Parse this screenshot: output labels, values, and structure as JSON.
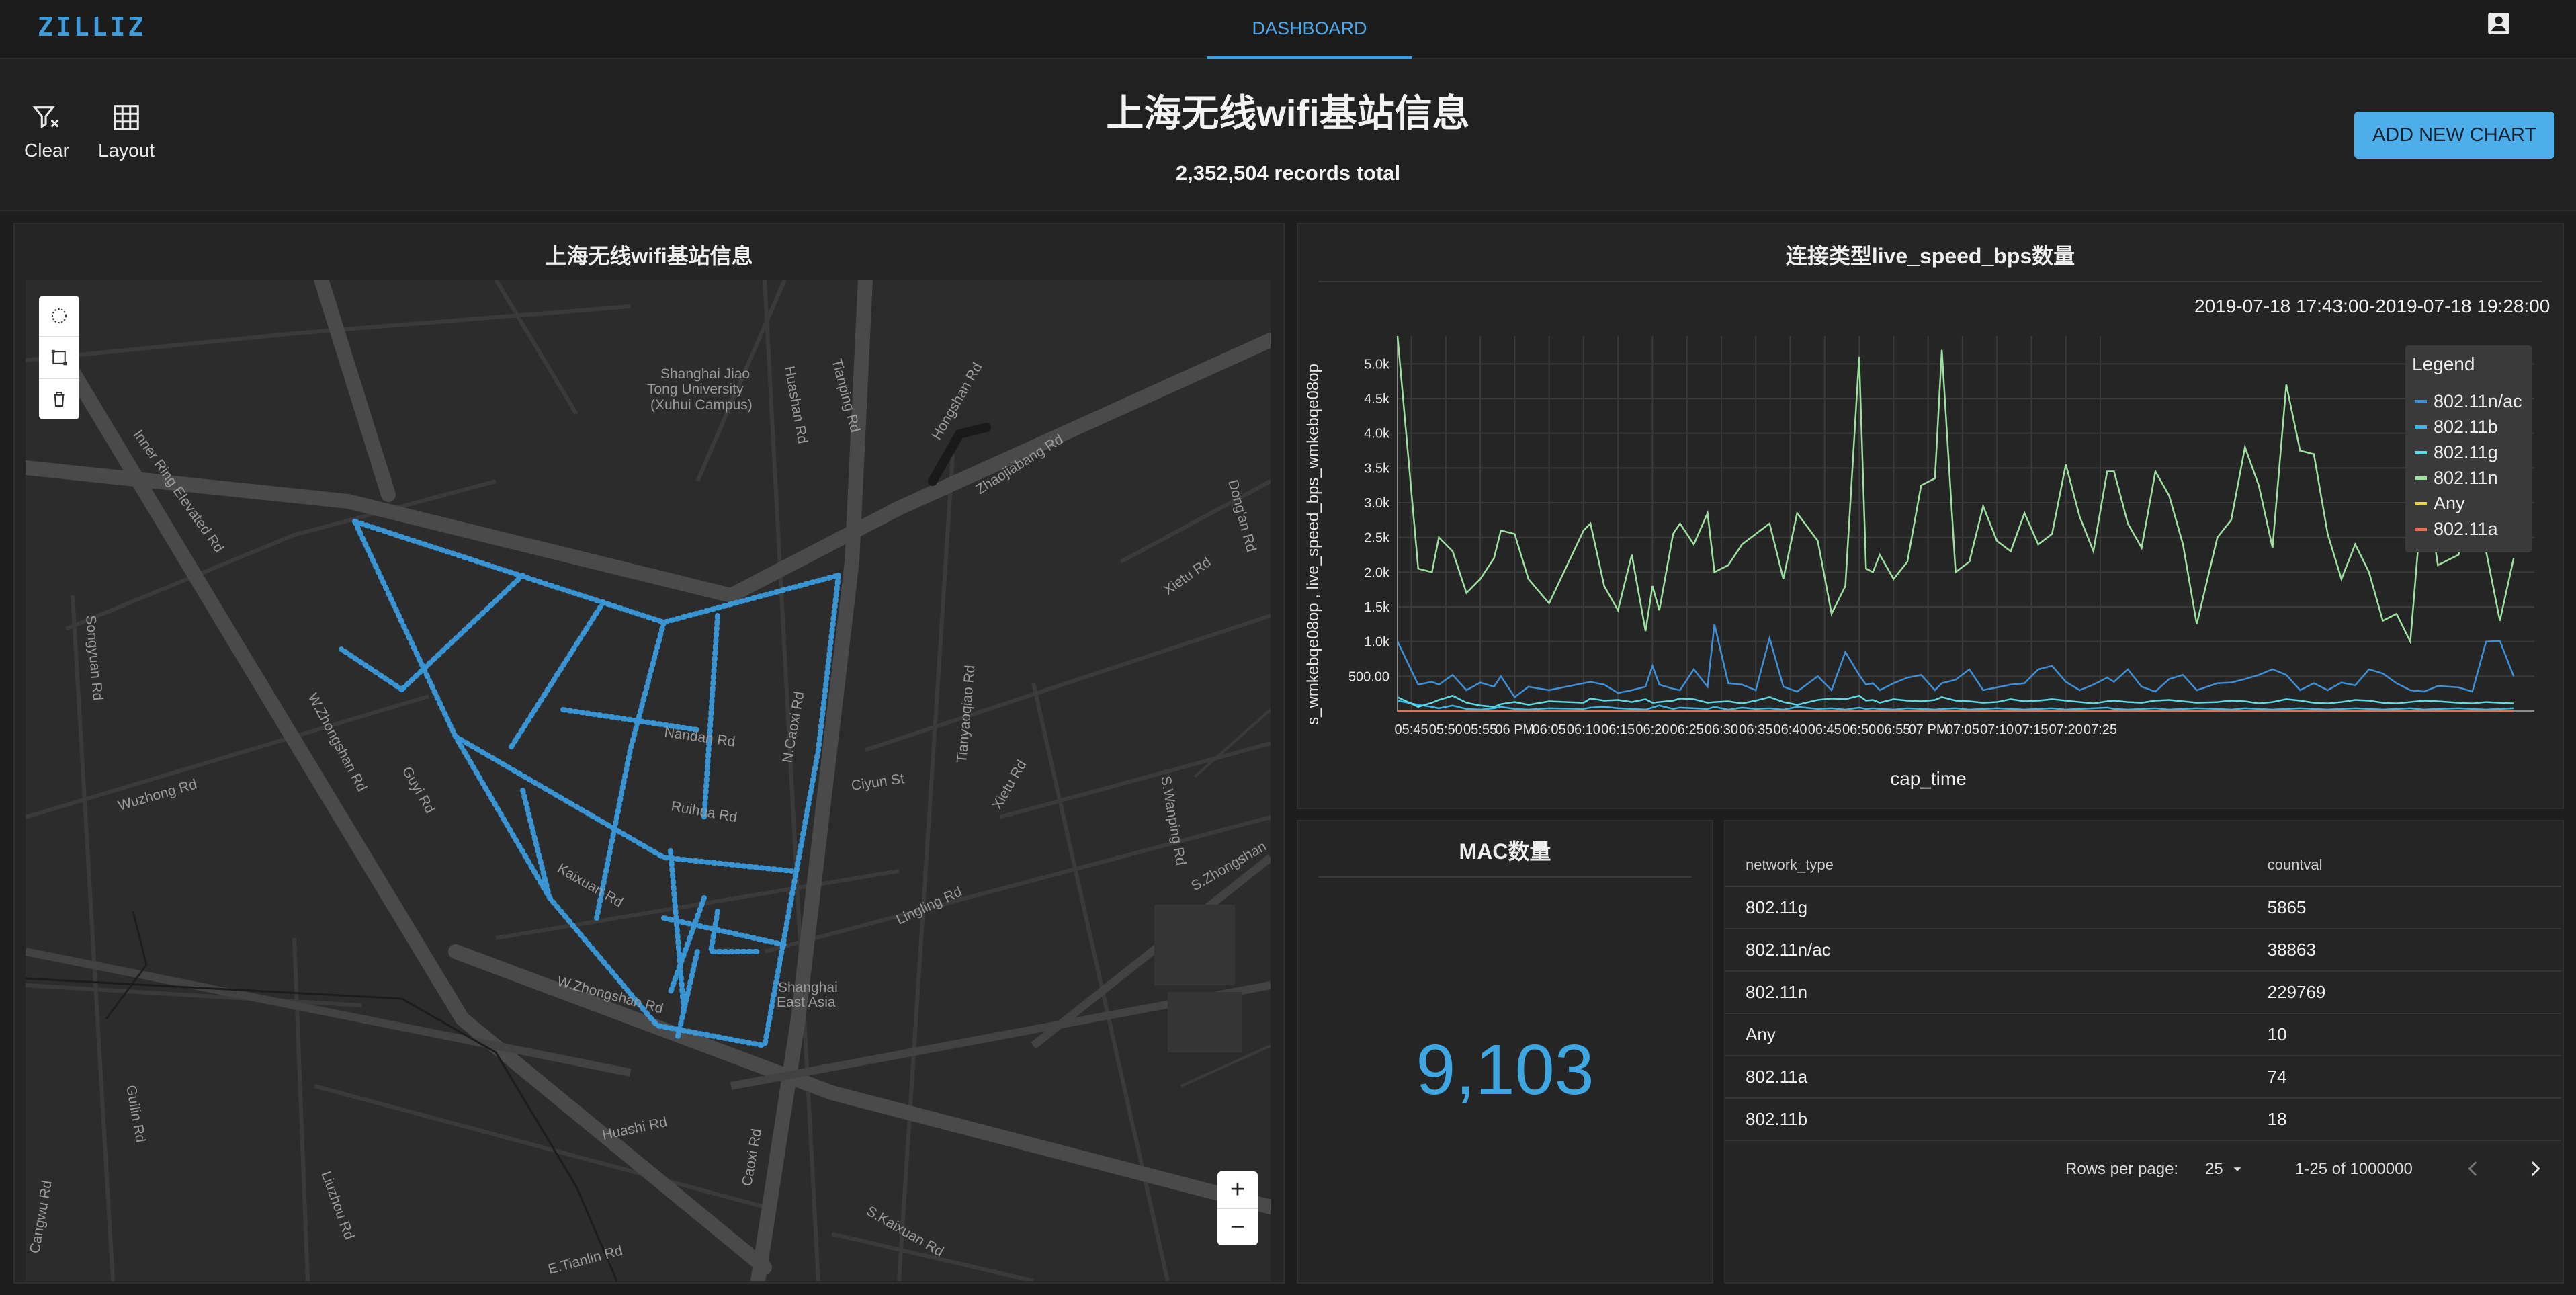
{
  "app": {
    "logo": "ZILLIZ",
    "nav_tab": "DASHBOARD"
  },
  "header": {
    "title": "上海无线wifi基站信息",
    "records": "2,352,504 records total",
    "tools": {
      "clear": "Clear",
      "layout": "Layout"
    },
    "add_chart": "ADD NEW CHART"
  },
  "map_panel": {
    "title": "上海无线wifi基站信息",
    "labels": {
      "sjtu": "Shanghai Jiao",
      "sjtu2": "Tong University",
      "sjtu3": "(Xuhui Campus)",
      "inner_ring": "Inner Ring Elevated Rd",
      "zhaojiabang": "Zhaojiabang Rd",
      "hongshan": "Hongshan Rd",
      "huashan": "Huashan Rd",
      "tianping": "Tianping Rd",
      "songyuan": "Songyuan Rd",
      "zhongshan_w": "W.Zhongshan Rd",
      "wuzhong": "Wuzhong Rd",
      "nandan": "Nandan Rd",
      "nandan_e": "Nandan Rd",
      "caoxi_n": "N.Caoxi Rd",
      "kaixuan": "Kaixuan Rd",
      "wzhongshan": "W.Zhongshan Rd",
      "tianyaoqiao": "Tianyaoqiao Rd",
      "lingling": "Lingling Rd",
      "xietu": "Xietu Rd",
      "xietu2": "Xietu Rd",
      "ciyun": "Ciyun St",
      "guyi": "Guyi Rd",
      "shanghai_ea": "Shanghai",
      "shanghai_ea2": "East Asia",
      "huashi": "Huashi Rd",
      "caoxi": "Caoxi Rd",
      "kaixuan_s": "S.Kaixuan Rd",
      "luizhou": "Liuzhou Rd",
      "guilin": "Guilin Rd",
      "tianlin": "E.Tianlin Rd",
      "wanping": "S.Wanping Rd",
      "dongan": "Dong'an Rd",
      "zhongshan_s": "S.Zhongshan",
      "caoxi_rd": "Caoxi Rd",
      "cangwu": "Cangwu Rd",
      "zhongshan2": "Zhongshan Rd",
      "rui": "Ruihua Rd",
      "zhangliang": "Zhaojiabang Rd"
    }
  },
  "line_panel": {
    "title": "连接类型live_speed_bps数量",
    "range": "2019-07-18 17:43:00-2019-07-18 19:28:00",
    "legend_title": "Legend"
  },
  "chart_data": {
    "type": "line",
    "title": "连接类型live_speed_bps数量",
    "xlabel": "cap_time",
    "ylabel": "s_wmkebqe08op , live_speed_bps_wmkebqe08op",
    "x_ticks": [
      "05:45",
      "05:50",
      "05:55",
      "06 PM",
      "06:05",
      "06:10",
      "06:15",
      "06:20",
      "06:25",
      "06:30",
      "06:35",
      "06:40",
      "06:45",
      "06:50",
      "06:55",
      "07 PM",
      "07:05",
      "07:10",
      "07:15",
      "07:20",
      "07:25"
    ],
    "y_ticks": [
      "500.00",
      "1.0k",
      "1.5k",
      "2.0k",
      "2.5k",
      "3.0k",
      "3.5k",
      "4.0k",
      "4.5k",
      "5.0k"
    ],
    "ylim": [
      0,
      5400
    ],
    "grid": true,
    "legend_position": "top-right",
    "x_minutes": [
      43,
      46,
      48,
      49,
      51,
      53,
      55,
      57,
      58,
      60,
      62,
      65,
      70,
      71,
      73,
      75,
      77,
      79,
      80,
      81,
      83,
      84,
      86,
      88,
      89,
      91,
      93,
      95,
      97,
      99,
      101,
      104,
      106,
      108,
      110,
      111,
      112,
      113,
      115,
      117,
      119,
      121,
      122,
      124,
      126,
      128,
      130,
      132,
      134,
      136,
      138,
      140,
      142,
      144,
      146,
      147,
      149,
      151,
      153,
      155,
      157,
      159,
      162,
      164,
      166,
      168,
      170,
      172,
      174,
      176,
      178,
      180,
      182,
      184,
      186,
      188,
      190,
      192,
      194,
      197,
      199,
      201,
      203,
      205
    ],
    "series": [
      {
        "name": "802.11n/ac",
        "color": "#3e8fd6",
        "values": [
          1000,
          380,
          420,
          380,
          520,
          300,
          410,
          350,
          500,
          200,
          350,
          300,
          400,
          420,
          380,
          260,
          300,
          350,
          650,
          380,
          320,
          300,
          600,
          350,
          1250,
          400,
          380,
          300,
          1050,
          350,
          280,
          500,
          300,
          850,
          520,
          380,
          400,
          300,
          400,
          480,
          520,
          300,
          400,
          450,
          600,
          300,
          340,
          380,
          400,
          600,
          650,
          420,
          300,
          380,
          480,
          420,
          600,
          350,
          280,
          460,
          520,
          300,
          400,
          410,
          460,
          520,
          600,
          520,
          300,
          400,
          300,
          410,
          370,
          600,
          540,
          400,
          300,
          280,
          360,
          340,
          280,
          1000,
          1010,
          500
        ]
      },
      {
        "name": "802.11b",
        "color": "#35b7e8",
        "values": [
          150,
          90,
          60,
          40,
          80,
          30,
          20,
          40,
          60,
          30,
          20,
          40,
          30,
          50,
          60,
          40,
          30,
          20,
          50,
          80,
          30,
          50,
          40,
          30,
          60,
          20,
          50,
          30,
          40,
          20,
          60,
          30,
          40,
          20,
          50,
          30,
          40,
          30,
          20,
          40,
          30,
          20,
          30,
          40,
          20,
          30,
          40,
          30,
          20,
          30,
          40,
          20,
          30,
          40,
          50,
          30,
          20,
          30,
          40,
          20,
          30,
          40,
          30,
          20,
          40,
          30,
          20,
          30,
          40,
          30,
          20,
          30,
          40,
          30,
          20,
          30,
          40,
          20,
          30,
          40,
          30,
          20,
          30,
          40
        ]
      },
      {
        "name": "802.11g",
        "color": "#5ed9e6",
        "values": [
          200,
          60,
          120,
          160,
          220,
          120,
          80,
          60,
          100,
          130,
          90,
          140,
          120,
          180,
          150,
          160,
          130,
          170,
          120,
          130,
          150,
          180,
          170,
          120,
          130,
          140,
          110,
          150,
          200,
          130,
          90,
          160,
          180,
          170,
          220,
          150,
          160,
          120,
          170,
          150,
          140,
          160,
          200,
          150,
          140,
          120,
          130,
          170,
          140,
          150,
          170,
          150,
          130,
          110,
          140,
          150,
          130,
          120,
          150,
          160,
          140,
          120,
          130,
          150,
          140,
          110,
          130,
          170,
          150,
          120,
          110,
          130,
          160,
          150,
          120,
          110,
          130,
          150,
          140,
          120,
          110,
          130,
          120,
          110
        ]
      },
      {
        "name": "802.11n",
        "color": "#9ee0a0",
        "values": [
          5400,
          2050,
          2000,
          2500,
          2300,
          1700,
          1900,
          2200,
          2600,
          2550,
          1900,
          1550,
          2600,
          2700,
          1800,
          1450,
          2250,
          1150,
          1800,
          1450,
          2550,
          2700,
          2400,
          2850,
          2000,
          2100,
          2400,
          2550,
          2700,
          1900,
          2850,
          2450,
          1400,
          1800,
          5100,
          2050,
          2000,
          2250,
          1900,
          2150,
          3250,
          3350,
          5200,
          2000,
          2150,
          2950,
          2450,
          2300,
          2850,
          2400,
          2550,
          3550,
          2800,
          2300,
          3450,
          3450,
          2700,
          2350,
          3450,
          3100,
          2400,
          1250,
          2500,
          2750,
          3800,
          3250,
          2350,
          4700,
          3750,
          3700,
          2550,
          1900,
          2400,
          2000,
          1300,
          1400,
          1000,
          3400,
          2100,
          2250,
          3000,
          2300,
          1300,
          2200
        ]
      },
      {
        "name": "Any",
        "color": "#e8d14b",
        "values": [
          0,
          0,
          0,
          0,
          0,
          0,
          0,
          0,
          0,
          0,
          0,
          0,
          0,
          0,
          0,
          0,
          0,
          0,
          0,
          0,
          0,
          0,
          0,
          0,
          0,
          0,
          0,
          0,
          0,
          0,
          0,
          0,
          0,
          0,
          0,
          0,
          0,
          0,
          0,
          0,
          0,
          0,
          0,
          0,
          0,
          0,
          0,
          0,
          0,
          0,
          0,
          0,
          0,
          0,
          0,
          0,
          0,
          0,
          0,
          0,
          0,
          0,
          0,
          0,
          0,
          0,
          0,
          0,
          0,
          0,
          0,
          0,
          0,
          0,
          0,
          0,
          0,
          0,
          0,
          0,
          0,
          0,
          0,
          0
        ]
      },
      {
        "name": "802.11a",
        "color": "#e56f5a",
        "values": [
          0,
          0,
          0,
          0,
          0,
          0,
          0,
          0,
          0,
          0,
          0,
          0,
          0,
          0,
          0,
          0,
          0,
          0,
          0,
          0,
          0,
          0,
          0,
          0,
          0,
          0,
          0,
          0,
          0,
          0,
          0,
          0,
          0,
          0,
          0,
          0,
          0,
          0,
          0,
          0,
          0,
          0,
          0,
          0,
          0,
          0,
          0,
          0,
          0,
          0,
          0,
          0,
          0,
          0,
          0,
          0,
          0,
          0,
          0,
          0,
          0,
          0,
          0,
          0,
          0,
          0,
          0,
          0,
          0,
          0,
          0,
          0,
          0,
          0,
          0,
          0,
          0,
          0,
          0,
          0,
          0,
          0,
          0,
          0
        ]
      }
    ]
  },
  "mac_panel": {
    "title": "MAC数量",
    "value": "9,103"
  },
  "table": {
    "headers": [
      "network_type",
      "countval"
    ],
    "rows": [
      [
        "802.11g",
        "5865"
      ],
      [
        "802.11n/ac",
        "38863"
      ],
      [
        "802.11n",
        "229769"
      ],
      [
        "Any",
        "10"
      ],
      [
        "802.11a",
        "74"
      ],
      [
        "802.11b",
        "18"
      ]
    ],
    "rows_per_page_label": "Rows per page:",
    "rows_per_page": "25",
    "range": "1-25 of 1000000"
  },
  "colors": {
    "accent": "#4eaeea",
    "map_dots": "#3aa0e6"
  }
}
